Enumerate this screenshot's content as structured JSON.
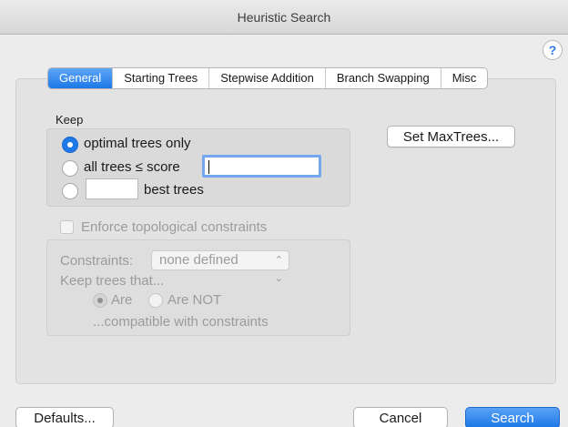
{
  "window": {
    "title": "Heuristic Search"
  },
  "help": {
    "label": "?"
  },
  "tabs": [
    {
      "label": "General",
      "active": true
    },
    {
      "label": "Starting Trees",
      "active": false
    },
    {
      "label": "Stepwise Addition",
      "active": false
    },
    {
      "label": "Branch Swapping",
      "active": false
    },
    {
      "label": "Misc",
      "active": false
    }
  ],
  "keep": {
    "label": "Keep",
    "options": [
      {
        "label": "optimal trees only",
        "selected": true
      },
      {
        "label": "all trees ≤ score",
        "selected": false,
        "value": ""
      },
      {
        "label": "best trees",
        "selected": false,
        "value": ""
      }
    ]
  },
  "set_maxtrees": {
    "label": "Set MaxTrees..."
  },
  "enforce": {
    "label": "Enforce topological constraints",
    "checked": false,
    "enabled": false
  },
  "constraints": {
    "label": "Constraints:",
    "select_value": "none defined",
    "keep_trees_label": "Keep trees that...",
    "options": [
      {
        "label": "Are",
        "selected": true
      },
      {
        "label": "Are NOT",
        "selected": false
      }
    ],
    "suffix": "...compatible with constraints"
  },
  "footer": {
    "defaults_label": "Defaults...",
    "cancel_label": "Cancel",
    "search_label": "Search"
  },
  "colors": {
    "accent": "#1f7ae9",
    "disabled_text": "#9b9b9b"
  }
}
